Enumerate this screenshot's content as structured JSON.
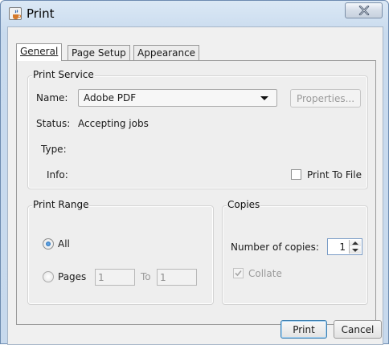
{
  "window": {
    "title": "Print",
    "close_glyph": "X"
  },
  "tabs": [
    {
      "label": "General",
      "mnemonic": "G"
    },
    {
      "label": "Page Setup",
      "mnemonic": "S"
    },
    {
      "label": "Appearance",
      "mnemonic": "A"
    }
  ],
  "print_service": {
    "group_title": "Print Service",
    "name_label": "Name:",
    "name_value": "Adobe PDF",
    "properties_label": "Properties...",
    "status_label": "Status:",
    "status_value": "Accepting jobs",
    "type_label": "Type:",
    "info_label": "Info:",
    "print_to_file_label": "Print To File",
    "print_to_file_checked": false
  },
  "print_range": {
    "group_title": "Print Range",
    "all_label": "All",
    "all_selected": true,
    "pages_label": "Pages",
    "from_value": "1",
    "to_label": "To",
    "to_value": "1"
  },
  "copies": {
    "group_title": "Copies",
    "number_label": "Number of copies:",
    "number_value": "1",
    "collate_label": "Collate",
    "collate_checked": true
  },
  "buttons": {
    "print": "Print",
    "cancel": "Cancel"
  }
}
